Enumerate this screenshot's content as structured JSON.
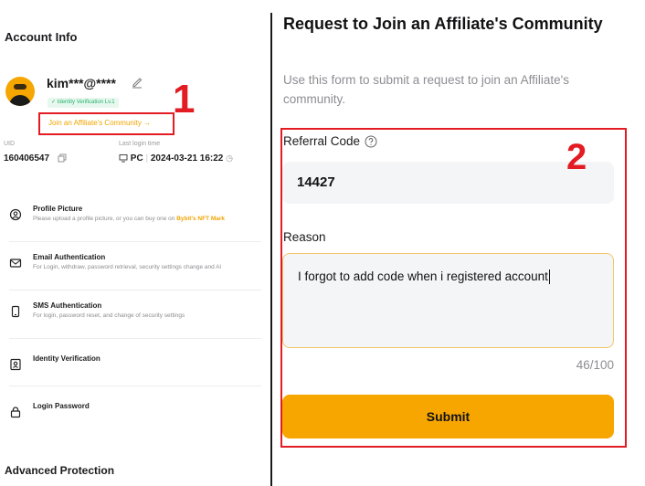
{
  "left": {
    "account_title": "Account Info",
    "username": "kim***@****",
    "verification_badge": "Identity Verification Lv.1",
    "join_link": "Join an Affiliate's Community →",
    "annotation_1": "1",
    "uid_label": "UID",
    "uid_value": "160406547",
    "last_login_label": "Last login time",
    "last_login_device": "PC",
    "last_login_time": "2024-03-21 16:22",
    "items": [
      {
        "title": "Profile Picture",
        "desc": "Please upload a profile picture, or you can buy one on",
        "desc_link": "Bybit's NFT Mark",
        "icon": "profile-icon"
      },
      {
        "title": "Email Authentication",
        "desc": "For Login, withdraw, password retrieval, security settings change and Al",
        "desc_link": "",
        "icon": "mail-icon"
      },
      {
        "title": "SMS Authentication",
        "desc": "For login, password reset, and change of security settings",
        "desc_link": "",
        "icon": "phone-icon"
      },
      {
        "title": "Identity Verification",
        "desc": "",
        "desc_link": "",
        "icon": "id-card-icon"
      },
      {
        "title": "Login Password",
        "desc": "",
        "desc_link": "",
        "icon": "lock-icon"
      }
    ],
    "advanced_title": "Advanced Protection"
  },
  "right": {
    "title": "Request to Join an Affiliate's Community",
    "description": "Use this form to submit a request to join an Affiliate's community.",
    "annotation_2": "2",
    "referral_label": "Referral Code",
    "referral_value": "14427",
    "reason_label": "Reason",
    "reason_value": "I forgot to add code when i registered account",
    "counter": "46/100",
    "submit_label": "Submit"
  },
  "colors": {
    "accent": "#f7a600",
    "annotation": "#e21c22",
    "success": "#20b26c"
  }
}
